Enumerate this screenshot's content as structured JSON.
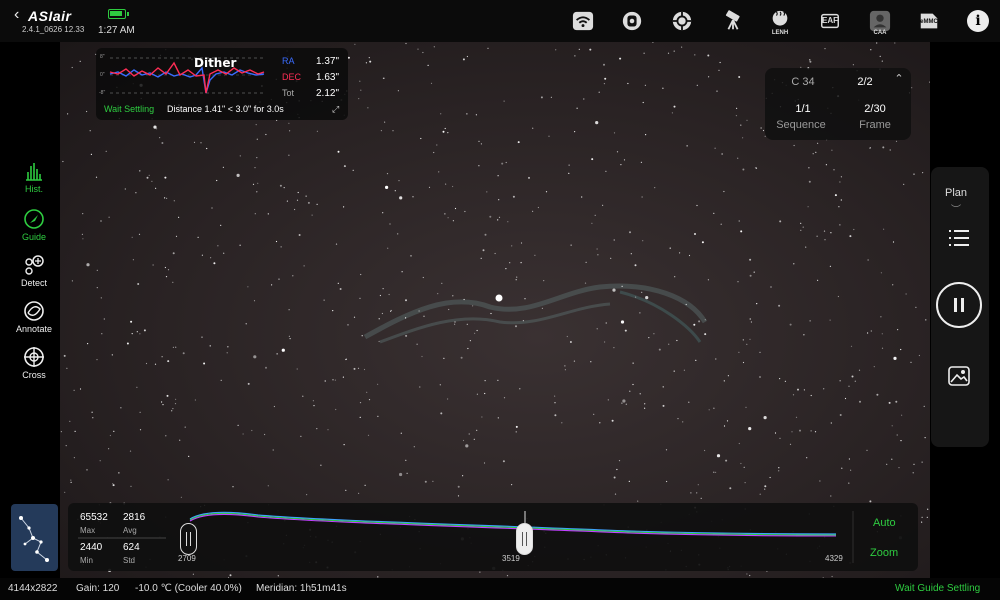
{
  "header": {
    "brand": "ASIair",
    "version": "2.4.1_0626 12.33",
    "time": "1:27 AM",
    "icons": [
      {
        "name": "wifi-icon"
      },
      {
        "name": "camera-icon"
      },
      {
        "name": "filter-wheel-icon"
      },
      {
        "name": "telescope-mount-icon"
      },
      {
        "name": "lens-heater-icon",
        "label": "LENH"
      },
      {
        "name": "focuser-icon",
        "label": "EAF"
      },
      {
        "name": "rotator-icon",
        "label": "CAA"
      },
      {
        "name": "storage-icon",
        "label": "eMMC"
      }
    ]
  },
  "guide": {
    "title": "Dither",
    "ra_label": "RA",
    "ra_value": "1.37\"",
    "dec_label": "DEC",
    "dec_value": "1.63\"",
    "tot_label": "Tot",
    "tot_value": "2.12\"",
    "status": "Wait Settling",
    "distance": "Distance 1.41\" < 3.0\" for 3.0s",
    "axis_labels": [
      "8\"",
      "0\"",
      "-8\""
    ],
    "colors": {
      "ra": "#3a6cff",
      "dec": "#ff2d55"
    }
  },
  "sequence": {
    "target": "C 34",
    "group": "2/2",
    "seq_value": "1/1",
    "seq_label": "Sequence",
    "frame_value": "2/30",
    "frame_label": "Frame"
  },
  "left_tools": [
    {
      "label": "Hist.",
      "active": true
    },
    {
      "label": "Guide",
      "active": true
    },
    {
      "label": "Detect",
      "active": false
    },
    {
      "label": "Annotate",
      "active": false
    },
    {
      "label": "Cross",
      "active": false
    }
  ],
  "right_panel": {
    "plan_label": "Plan"
  },
  "histogram": {
    "max_value": "65532",
    "max_label": "Max",
    "avg_value": "2816",
    "avg_label": "Avg",
    "min_value": "2440",
    "min_label": "Min",
    "std_value": "624",
    "std_label": "Std",
    "left_tick": "2709",
    "mid_tick": "3519",
    "right_tick": "4329",
    "auto_label": "Auto",
    "zoom_label": "Zoom"
  },
  "status": {
    "resolution": "4144x2822",
    "gain": "Gain: 120",
    "temperature": "-10.0 ℃ (Cooler 40.0%)",
    "meridian": "Meridian: 1h51m41s",
    "state": "Wait Guide Settling"
  }
}
